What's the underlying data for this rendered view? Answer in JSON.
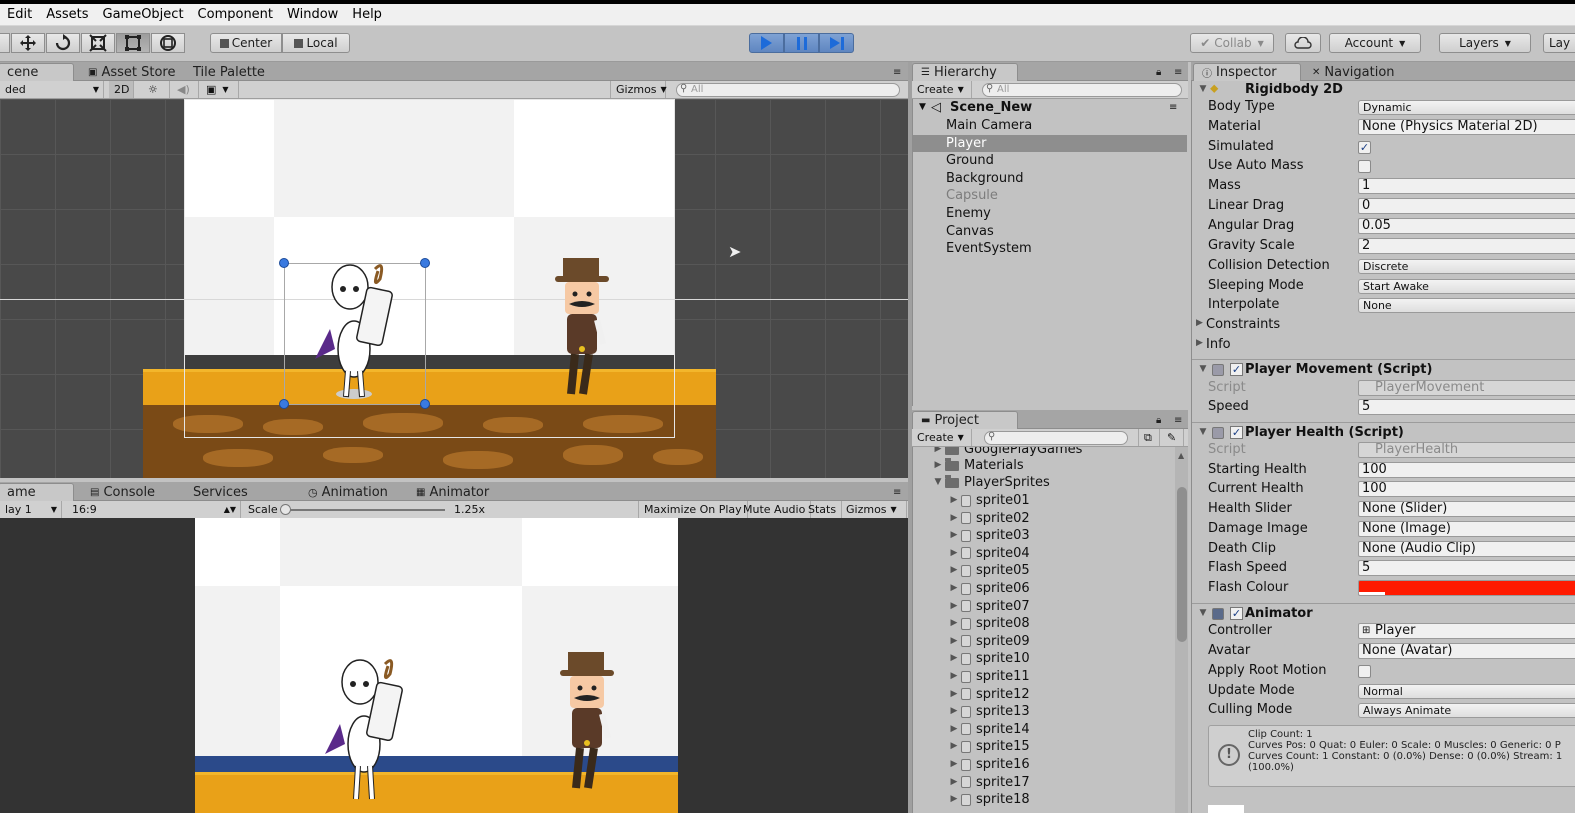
{
  "menu": [
    "Edit",
    "Assets",
    "GameObject",
    "Component",
    "Window",
    "Help"
  ],
  "toolbar": {
    "pivot": "Center",
    "space": "Local",
    "collab": "Collab",
    "account": "Account",
    "layers": "Layers",
    "layout": "Lay"
  },
  "scene": {
    "tabs": [
      "cene",
      "Asset Store",
      "Tile Palette"
    ],
    "shading": "ded",
    "mode2d": "2D",
    "gizmos": "Gizmos",
    "search": "All"
  },
  "game": {
    "tabs": [
      "ame",
      "Console",
      "Services",
      "Animation",
      "Animator"
    ],
    "display": "lay 1",
    "aspect": "16:9",
    "scale_label": "Scale",
    "scale_value": "1.25x",
    "scale_fraction": 0.0,
    "maximize": "Maximize On Play",
    "mute": "Mute Audio",
    "stats": "Stats",
    "gizmos": "Gizmos"
  },
  "hierarchy": {
    "tab": "Hierarchy",
    "create": "Create",
    "search": "All",
    "scene_name": "Scene_New",
    "items": [
      {
        "label": "Main Camera",
        "state": "normal"
      },
      {
        "label": "Player",
        "state": "selected"
      },
      {
        "label": "Ground",
        "state": "normal"
      },
      {
        "label": "Background",
        "state": "normal"
      },
      {
        "label": "Capsule",
        "state": "disabled"
      },
      {
        "label": "Enemy",
        "state": "normal"
      },
      {
        "label": "Canvas",
        "state": "normal"
      },
      {
        "label": "EventSystem",
        "state": "normal"
      }
    ]
  },
  "project": {
    "tab": "Project",
    "create": "Create",
    "folders": [
      "GooglePlayGames",
      "Materials",
      "PlayerSprites"
    ],
    "sprites": [
      "sprite01",
      "sprite02",
      "sprite03",
      "sprite04",
      "sprite05",
      "sprite06",
      "sprite07",
      "sprite08",
      "sprite09",
      "sprite10",
      "sprite11",
      "sprite12",
      "sprite13",
      "sprite14",
      "sprite15",
      "sprite16",
      "sprite17",
      "sprite18"
    ]
  },
  "inspector": {
    "tabs": [
      "Inspector",
      "Navigation"
    ],
    "rigidbody": {
      "title": "Rigidbody 2D",
      "body_type_label": "Body Type",
      "body_type": "Dynamic",
      "material_label": "Material",
      "material": "None (Physics Material 2D)",
      "simulated_label": "Simulated",
      "auto_mass_label": "Use Auto Mass",
      "mass_label": "Mass",
      "mass": "1",
      "linear_drag_label": "Linear Drag",
      "linear_drag": "0",
      "angular_drag_label": "Angular Drag",
      "angular_drag": "0.05",
      "gravity_label": "Gravity Scale",
      "gravity": "2",
      "collision_label": "Collision Detection",
      "collision": "Discrete",
      "sleeping_label": "Sleeping Mode",
      "sleeping": "Start Awake",
      "interpolate_label": "Interpolate",
      "interpolate": "None",
      "constraints": "Constraints",
      "info": "Info"
    },
    "movement": {
      "title": "Player Movement (Script)",
      "script_label": "Script",
      "script": "PlayerMovement",
      "speed_label": "Speed",
      "speed": "5"
    },
    "health": {
      "title": "Player Health (Script)",
      "script_label": "Script",
      "script": "PlayerHealth",
      "starting_label": "Starting Health",
      "starting": "100",
      "current_label": "Current Health",
      "current": "100",
      "slider_label": "Health Slider",
      "slider": "None (Slider)",
      "damage_label": "Damage Image",
      "damage": "None (Image)",
      "death_label": "Death Clip",
      "death": "None (Audio Clip)",
      "flash_speed_label": "Flash Speed",
      "flash_speed": "5",
      "flash_colour_label": "Flash Colour",
      "flash_colour": "#ff1a00"
    },
    "animator": {
      "title": "Animator",
      "controller_label": "Controller",
      "controller": "Player",
      "avatar_label": "Avatar",
      "avatar": "None (Avatar)",
      "root_motion_label": "Apply Root Motion",
      "update_label": "Update Mode",
      "update": "Normal",
      "culling_label": "Culling Mode",
      "culling": "Always Animate",
      "info_line1": "Clip Count: 1",
      "info_line2": "Curves Pos: 0 Quat: 0 Euler: 0 Scale: 0 Muscles: 0 Generic: 0 P",
      "info_line3": "Curves Count: 1 Constant: 0 (0.0%) Dense: 0 (0.0%) Stream: 1",
      "info_line4": "(100.0%)"
    }
  }
}
